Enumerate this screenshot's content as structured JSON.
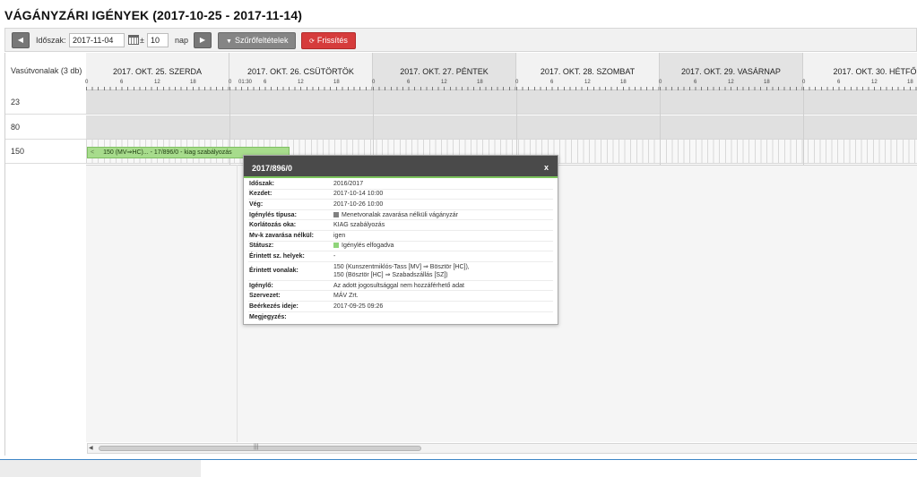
{
  "page": {
    "title": "VÁGÁNYZÁRI IGÉNYEK (2017-10-25 - 2017-11-14)"
  },
  "toolbar": {
    "prev_icon": "◀",
    "next_icon": "▶",
    "period_label": "Időszak:",
    "date_value": "2017-11-04",
    "plusminus": "±",
    "range_value": "10",
    "unit_label": "nap",
    "filter_icon": "▼",
    "filter_label": "Szűrőfeltételek",
    "refresh_icon": "⟳",
    "refresh_label": "Frissítés",
    "filter_color": "#858585",
    "refresh_color": "#d63c3c"
  },
  "grid": {
    "rows_header": "Vasútvonalak (3 db)",
    "days": [
      {
        "label": "2017. OKT. 25. SZERDA",
        "weekend": false
      },
      {
        "label": "2017. OKT. 26. CSÜTÖRTÖK",
        "weekend": false
      },
      {
        "label": "2017. OKT. 27. PÉNTEK",
        "weekend": true
      },
      {
        "label": "2017. OKT. 28. SZOMBAT",
        "weekend": false
      },
      {
        "label": "2017. OKT. 29. VASÁRNAP",
        "weekend": true
      },
      {
        "label": "2017. OKT. 30. HÉTFŐ",
        "weekend": false
      }
    ],
    "hour_labels": [
      "0",
      "6",
      "12",
      "18"
    ],
    "extra_marker": "01:30",
    "rows": [
      "23",
      "80",
      "150"
    ]
  },
  "event": {
    "arrow": "<",
    "label": "150 (MV⇒HC)... - 17/896/0 - kiag szabályozás",
    "color": "#a7dc8c"
  },
  "scroll": {
    "left_arrow": "◀",
    "grip": "|||"
  },
  "popup": {
    "title": "2017/896/0",
    "close": "x",
    "accent_color": "#7cc45c",
    "rows": {
      "idoszak": {
        "key": "Időszak:",
        "value": "2016/2017"
      },
      "kezdet": {
        "key": "Kezdet:",
        "value": "2017-10-14 10:00"
      },
      "veg": {
        "key": "Vég:",
        "value": "2017-10-26 10:00"
      },
      "tipus": {
        "key": "Igénylés típusa:",
        "value": "Menetvonalak zavarása nélküli vágányzár",
        "square_color": "#808080"
      },
      "ok": {
        "key": "Korlátozás oka:",
        "value": "KIAG szabályozás"
      },
      "mv": {
        "key": "Mv-k zavarása nélkül:",
        "value": "igen"
      },
      "statusz": {
        "key": "Státusz:",
        "value": "Igénylés elfogadva",
        "square_color": "#8fd47a"
      },
      "helyek": {
        "key": "Érintett sz. helyek:",
        "value": "-"
      },
      "vonalak": {
        "key": "Érintett vonalak:",
        "value_1": "150 (Kunszentmiklós-Tass [MV] ⇒ Bösztör [HC]),",
        "value_2": "150 (Bösztör [HC] ⇒ Szabadszállás [SZ])"
      },
      "igenylo": {
        "key": "Igénylő:",
        "value": "Az adott jogosultsággal nem hozzáférhető adat"
      },
      "szervezet": {
        "key": "Szervezet:",
        "value": "MÁV Zrt."
      },
      "beerkezes": {
        "key": "Beérkezés ideje:",
        "value": "2017-09-25 09:26"
      },
      "megjegyzes": {
        "key": "Megjegyzés:",
        "value": ""
      }
    }
  }
}
